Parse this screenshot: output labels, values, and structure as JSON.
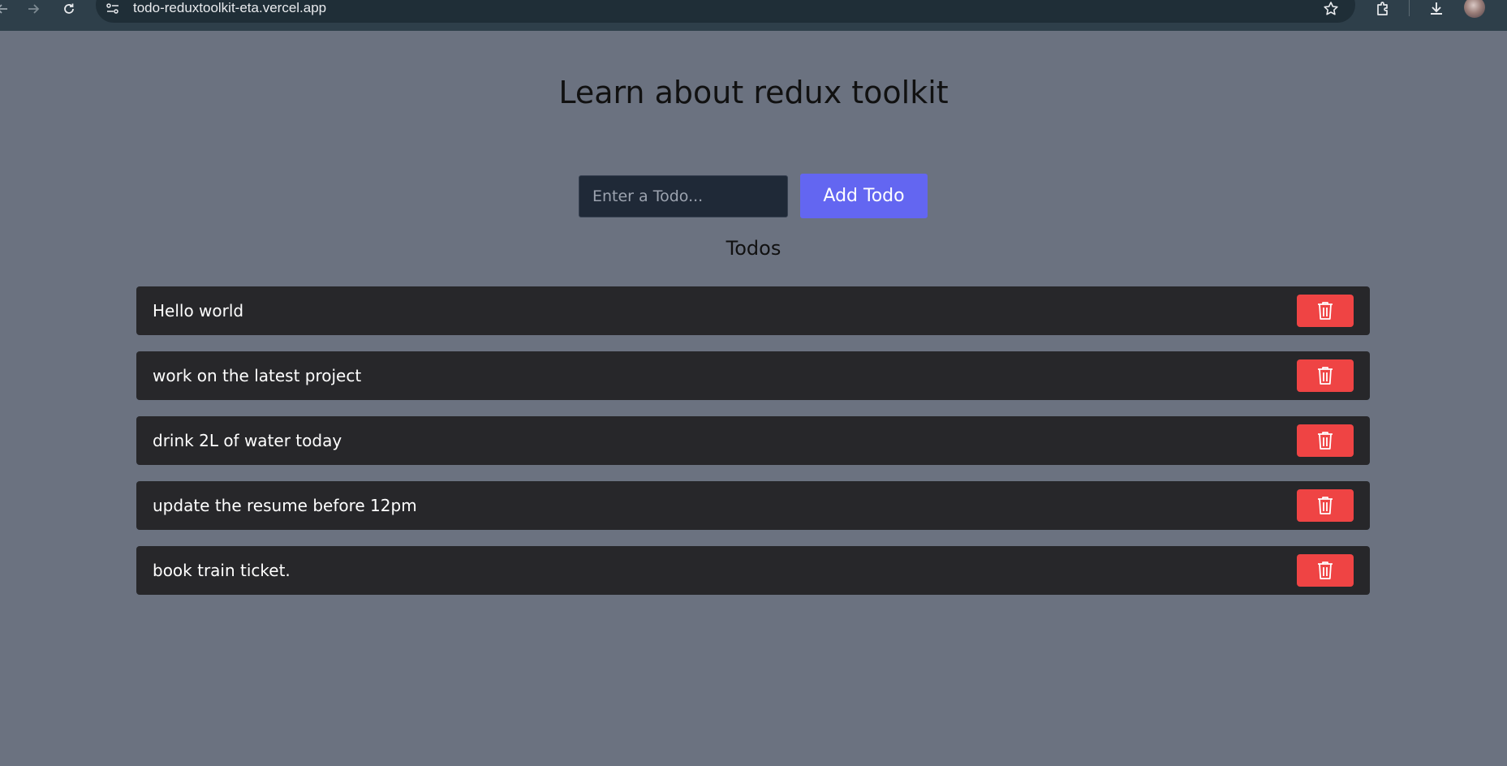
{
  "browser": {
    "url": "todo-reduxtoolkit-eta.vercel.app",
    "icons": [
      "back-arrow-icon",
      "forward-arrow-icon",
      "reload-icon",
      "site-info-icon",
      "star-icon",
      "extensions-icon",
      "download-icon",
      "avatar"
    ]
  },
  "app": {
    "title": "Learn about redux toolkit",
    "input_placeholder": "Enter a Todo...",
    "add_button_label": "Add Todo",
    "todos_heading": "Todos",
    "todos": [
      {
        "text": "Hello world"
      },
      {
        "text": "work on the latest project"
      },
      {
        "text": "drink 2L of water today"
      },
      {
        "text": "update the resume before 12pm"
      },
      {
        "text": "book train ticket."
      }
    ],
    "delete_icon": "trash-icon"
  },
  "colors": {
    "page_background": "#6b7280",
    "accent": "#6366f1",
    "danger": "#ef4444",
    "item_background": "#27272a",
    "input_background": "#1f2937"
  }
}
